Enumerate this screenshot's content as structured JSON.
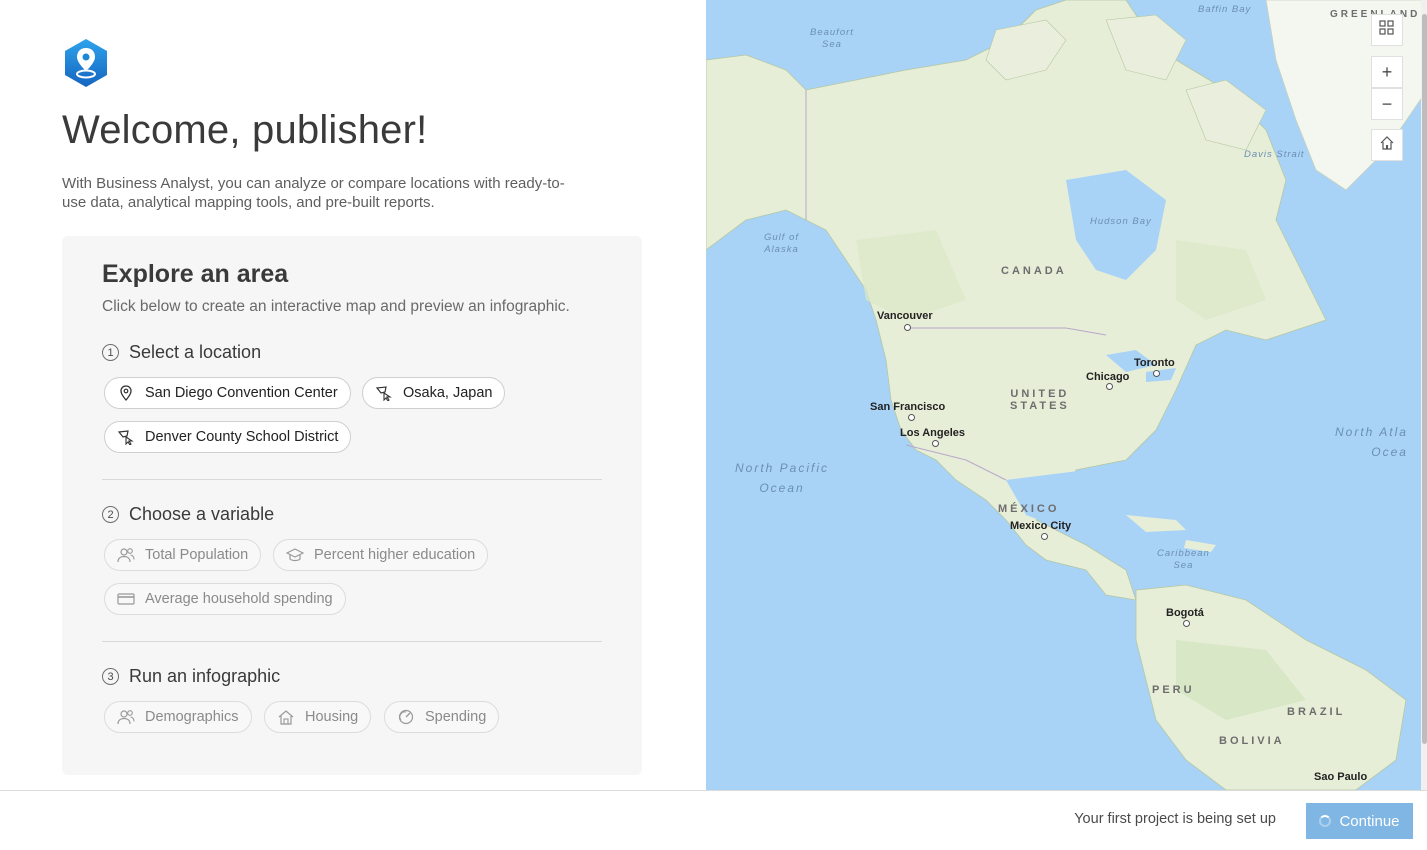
{
  "welcome": {
    "title": "Welcome, publisher!",
    "intro": "With Business Analyst, you can analyze or compare locations with ready-to-use data, analytical mapping tools, and pre-built reports."
  },
  "explore": {
    "title": "Explore an area",
    "subtitle": "Click below to create an interactive map and preview an infographic.",
    "steps": [
      {
        "number": "1",
        "label": "Select a location",
        "chips": [
          {
            "label": "San Diego Convention Center",
            "icon": "map-pin-icon"
          },
          {
            "label": "Osaka, Japan",
            "icon": "polygon-select-icon"
          },
          {
            "label": "Denver County School District",
            "icon": "polygon-select-icon"
          }
        ]
      },
      {
        "number": "2",
        "label": "Choose a variable",
        "chips": [
          {
            "label": "Total Population",
            "icon": "people-icon"
          },
          {
            "label": "Percent higher education",
            "icon": "graduation-cap-icon"
          },
          {
            "label": "Average household spending",
            "icon": "credit-card-icon"
          }
        ]
      },
      {
        "number": "3",
        "label": "Run an infographic",
        "chips": [
          {
            "label": "Demographics",
            "icon": "people-icon"
          },
          {
            "label": "Housing",
            "icon": "house-icon"
          },
          {
            "label": "Spending",
            "icon": "spending-dial-icon"
          }
        ]
      }
    ]
  },
  "map": {
    "cities": [
      "Vancouver",
      "San Francisco",
      "Los Angeles",
      "Chicago",
      "Toronto",
      "Mexico City",
      "Bogotá",
      "Sao Paulo"
    ],
    "countries": [
      "CANADA",
      "UNITED",
      "STATES",
      "MÉXICO",
      "PERU",
      "BRAZIL",
      "BOLIVIA",
      "GREENLAND"
    ],
    "water": {
      "beaufort1": "Beaufort",
      "beaufort2": "Sea",
      "baffin": "Baffin Bay",
      "davis": "Davis Strait",
      "hudson": "Hudson Bay",
      "alaska1": "Gulf of",
      "alaska2": "Alaska",
      "pacific1": "North Pacific",
      "pacific2": "Ocean",
      "atlantic1": "North Atla",
      "atlantic2": "Ocea",
      "caribbean1": "Caribbean",
      "caribbean2": "Sea"
    },
    "controls": {
      "zoom_in": "+",
      "zoom_out": "−"
    }
  },
  "footer": {
    "status": "Your first project is being set up",
    "continue_label": "Continue"
  },
  "colors": {
    "water": "#a8d3f7",
    "land": "#e9efdc",
    "accent": "#7fb6e3",
    "logo": "#1e88d6"
  }
}
